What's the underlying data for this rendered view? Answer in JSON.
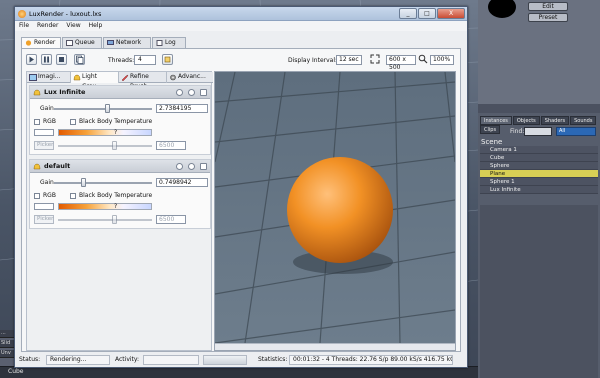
{
  "window": {
    "title": "LuxRender - luxout.lxs",
    "minimize": "_",
    "maximize": "□",
    "close": "X"
  },
  "menu": [
    "File",
    "Render",
    "View",
    "Help"
  ],
  "tabs": [
    "Render",
    "Queue",
    "Network",
    "Log"
  ],
  "toolbar": {
    "threads_label": "Threads:",
    "threads_value": "4",
    "display_interval_label": "Display Interval:",
    "display_interval_value": "12 sec",
    "resolution": "600 x 500",
    "zoom": "100%"
  },
  "subtabs": [
    "Imagi...",
    "Light Grou...",
    "Refine Brush",
    "Advanc..."
  ],
  "light_groups": [
    {
      "name": "Lux Infinite",
      "gain_label": "Gain",
      "gain_value": "2.7384195",
      "gain_fraction": 0.55,
      "rgb_label": "RGB",
      "bbt_label": "Black Body Temperature",
      "question": "?",
      "picker_label": "Picker",
      "temperature_value": "6500"
    },
    {
      "name": "default",
      "gain_label": "Gain",
      "gain_value": "0.7498942",
      "gain_fraction": 0.3,
      "rgb_label": "RGB",
      "bbt_label": "Black Body Temperature",
      "question": "?",
      "picker_label": "Picker",
      "temperature_value": "6500"
    }
  ],
  "status": {
    "status_label": "Status:",
    "status_value": "Rendering...",
    "activity_label": "Activity:",
    "statistics_label": "Statistics:",
    "statistics_value": "00:01:32 - 4 Threads: 22.76 S/p  89.00 kS/s  416.75 kC/s  464% Eff"
  },
  "right_panel": {
    "edit_button": "Edit",
    "preset_button": "Preset",
    "tabs": [
      "Instances",
      "Objects",
      "Shaders",
      "Sounds",
      "Clips"
    ],
    "find_label": "Find:",
    "filter_value": "All",
    "scene_title": "Scene",
    "items": [
      "Camera 1",
      "Cube",
      "Sphere",
      "Plane",
      "Sphere 1",
      "Lux Infinite"
    ],
    "selected_index": 3
  },
  "background": {
    "left_strip": [
      "...",
      "Slid",
      "Unv"
    ],
    "bottom_item": "Cube"
  },
  "colors": {
    "sphere": "#f08a1c",
    "selection": "#d8cf55",
    "title_bar": "#c8d8ec",
    "filter_select": "#2b68b5"
  }
}
